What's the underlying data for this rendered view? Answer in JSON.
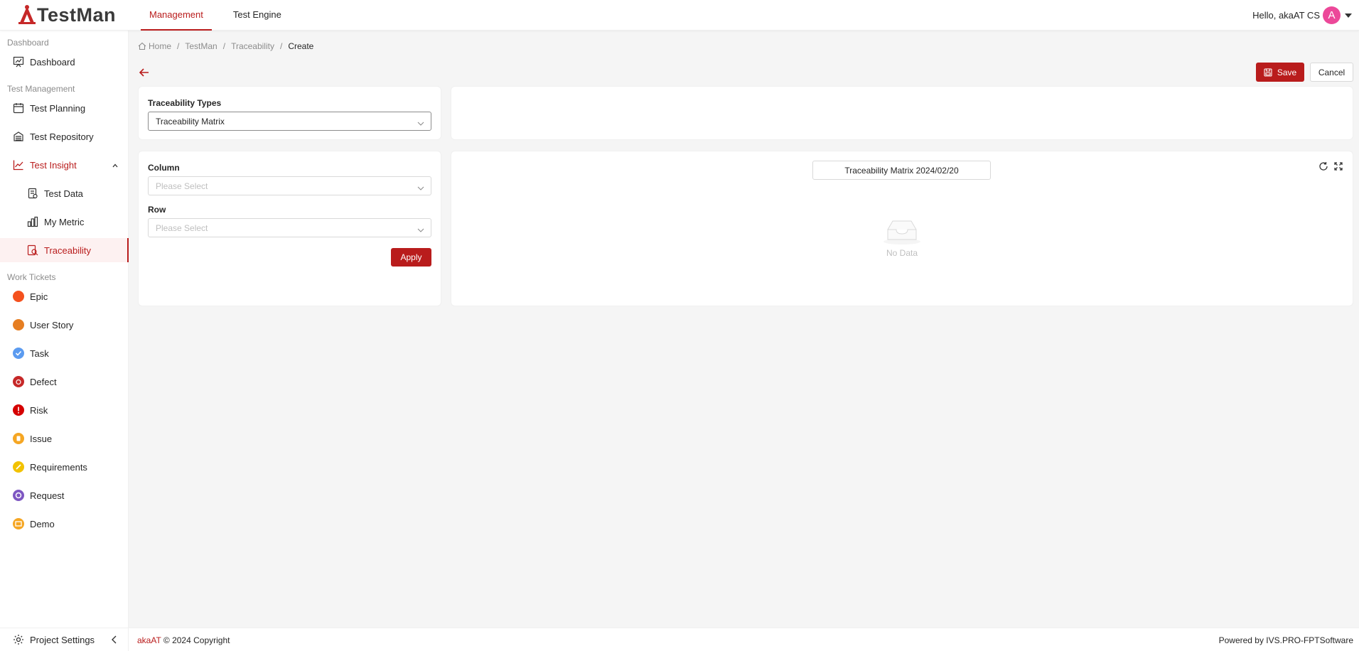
{
  "app": {
    "logo_text": "TestMan",
    "brand_color": "#b91c1c"
  },
  "topnav": {
    "items": [
      {
        "label": "Management",
        "active": true
      },
      {
        "label": "Test Engine",
        "active": false
      }
    ]
  },
  "user": {
    "greeting": "Hello, akaAT CS",
    "avatar_letter": "A",
    "avatar_color": "#ec4899"
  },
  "sidebar": {
    "groups": {
      "dashboard": "Dashboard",
      "test_management": "Test Management",
      "work_tickets": "Work Tickets"
    },
    "items": {
      "dashboard": "Dashboard",
      "test_planning": "Test Planning",
      "test_repository": "Test Repository",
      "test_insight": "Test Insight",
      "test_data": "Test Data",
      "my_metric": "My Metric",
      "traceability": "Traceability",
      "epic": "Epic",
      "user_story": "User Story",
      "task": "Task",
      "defect": "Defect",
      "risk": "Risk",
      "issue": "Issue",
      "requirements": "Requirements",
      "request": "Request",
      "demo": "Demo"
    },
    "ticket_colors": {
      "epic": "#f4511e",
      "user_story": "#e67e22",
      "task": "#5b9bf0",
      "defect": "#c62828",
      "risk": "#d50000",
      "issue": "#f5a623",
      "requirements": "#f2c200",
      "request": "#7e57c2",
      "demo": "#f5a623"
    },
    "footer_label": "Project Settings"
  },
  "breadcrumb": {
    "home": "Home",
    "items": [
      "TestMan",
      "Traceability"
    ],
    "current": "Create"
  },
  "actions": {
    "save": "Save",
    "cancel": "Cancel"
  },
  "types_panel": {
    "label": "Traceability Types",
    "value": "Traceability Matrix"
  },
  "filter_panel": {
    "column_label": "Column",
    "column_placeholder": "Please Select",
    "row_label": "Row",
    "row_placeholder": "Please Select",
    "apply": "Apply"
  },
  "result_panel": {
    "title": "Traceability Matrix 2024/02/20",
    "empty_text": "No Data"
  },
  "footer": {
    "brand": "akaAT",
    "copyright": " © 2024 Copyright",
    "powered_prefix": "Powered by ",
    "powered_by": "IVS.PRO-FPTSoftware"
  }
}
